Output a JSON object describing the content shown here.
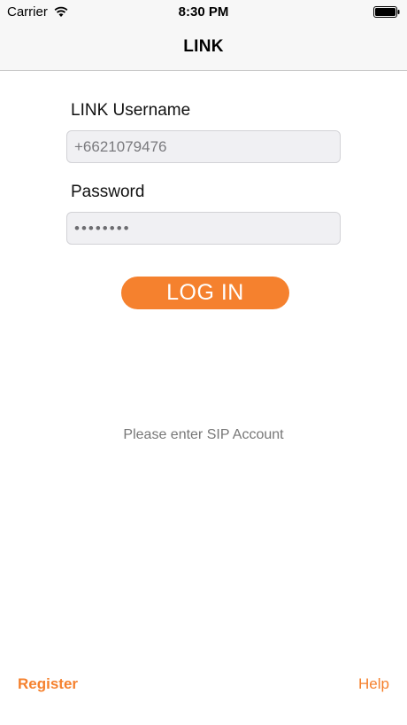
{
  "status_bar": {
    "carrier": "Carrier",
    "time": "8:30 PM"
  },
  "nav": {
    "title": "LINK"
  },
  "form": {
    "username_label": "LINK Username",
    "username_value": "+6621079476",
    "password_label": "Password",
    "password_value": "••••••••",
    "login_label": "LOG IN"
  },
  "hint": "Please enter SIP Account",
  "footer": {
    "register_label": "Register",
    "help_label": "Help"
  },
  "colors": {
    "accent": "#f5812e",
    "field_bg": "#f0f0f3",
    "hint_text": "#777777"
  }
}
